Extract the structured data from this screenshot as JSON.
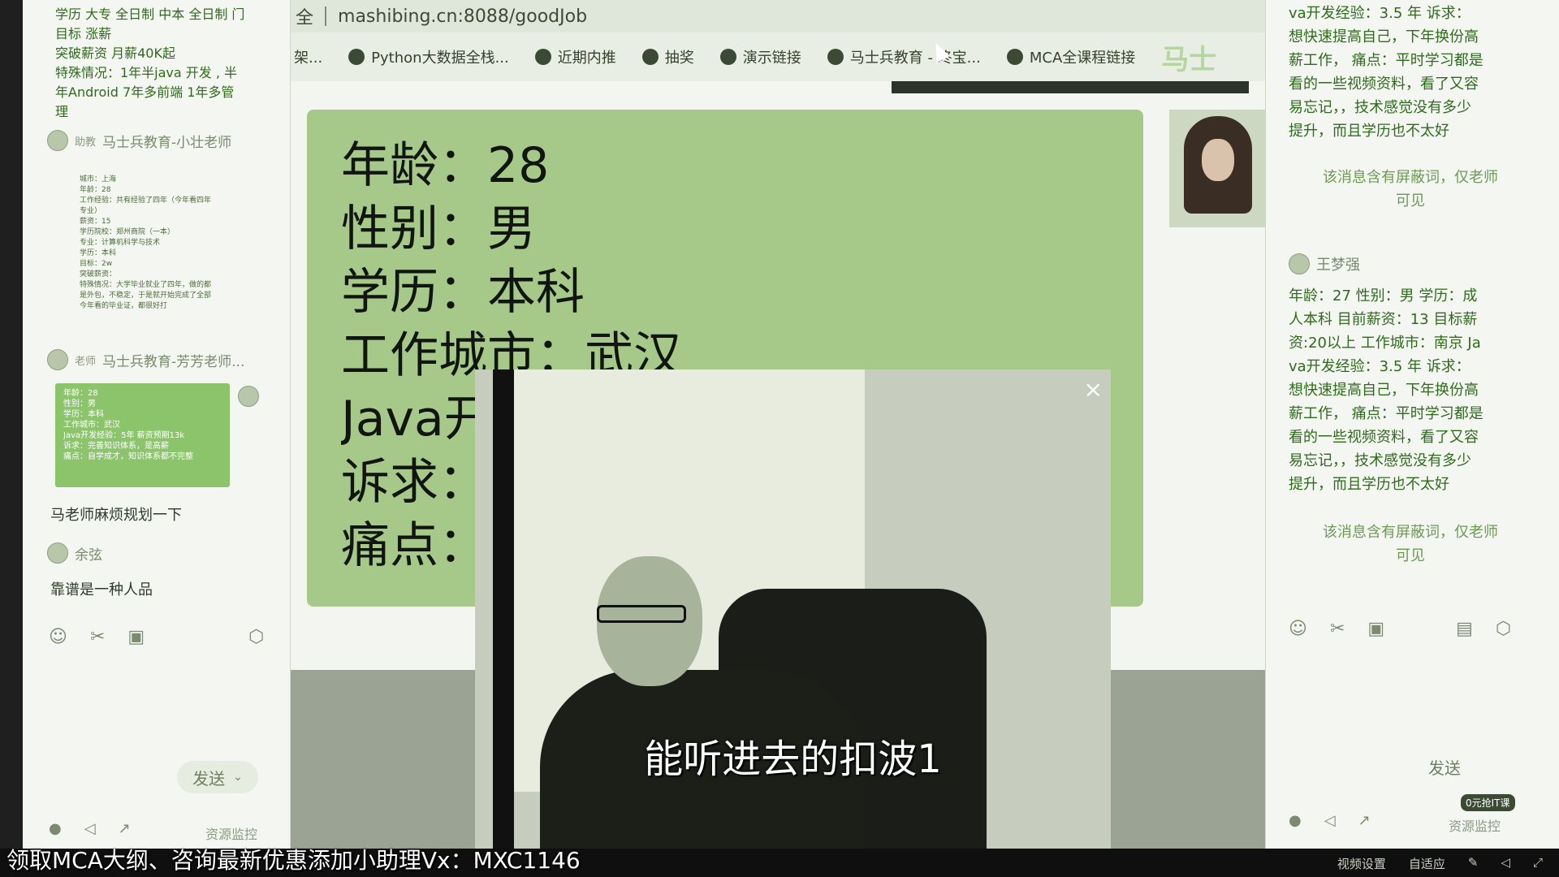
{
  "left_panel": {
    "notes": [
      "学历 大专 全日制 中本 全日制 门",
      "目标 涨薪",
      "突破薪资 月薪40K起",
      "特殊情况：1年半java 开发 , 半",
      "年Android 7年多前端 1年多管",
      "理"
    ],
    "msg1": {
      "role": "助教",
      "name": "马士兵教育-小壮老师"
    },
    "tiny_lines": [
      "城市：上海",
      "年龄：28",
      "工作经验：共有经验了四年（今年看四年",
      "专业）",
      "薪资：15",
      "学历院校：郑州商院（一本）",
      "专业：计算机科学与技术",
      "学历：本科",
      "目标：2w",
      "突破薪资：",
      "特殊情况：大学毕业就业了四年，做的都",
      "是外包，不稳定，于是就开始完成了全部",
      "今年看的毕业证，都很好打"
    ],
    "msg2": {
      "role": "老师",
      "name": "马士兵教育-芳芳老师..."
    },
    "green_lines": [
      "年龄：28",
      "性别：男",
      "学历：本科",
      "工作城市：武汉",
      "Java开发经验：5年 薪资预期13k",
      "诉求：完善知识体系，是高薪",
      "痛点：自学成才，知识体系都不完整"
    ],
    "msg3": "马老师麻烦规划一下",
    "msg4_name": "余弦",
    "msg4_text": "靠谱是一种人品",
    "send_label": "发送",
    "res_monitor": "资源监控"
  },
  "browser": {
    "url_prefix": "全",
    "url": "mashibing.cn:8088/goodJob",
    "bookmarks": [
      "架...",
      "Python大数据全栈...",
      "近期内推",
      "抽奖",
      "演示链接",
      "马士兵教育 - 咚宝...",
      "MCA全课程链接"
    ],
    "brand": "马士"
  },
  "card": {
    "lines": [
      "年龄：28",
      "性别：男",
      "学历：本科",
      "工作城市：武汉",
      "Java开",
      "诉求：",
      "痛点："
    ]
  },
  "video": {
    "subtitle": "能听进去的扣波1",
    "close": "×"
  },
  "right_panel": {
    "top_text": [
      "va开发经验：3.5 年 诉求：",
      "想快速提高自己，下年换份高",
      "薪工作， 痛点：平时学习都是",
      "看的一些视频资料，看了又容",
      "易忘记，，技术感觉没有多少",
      "提升，而且学历也不太好"
    ],
    "note1": [
      "该消息含有屏蔽词，仅老师",
      "可见"
    ],
    "user_name": "王梦强",
    "msg_text": [
      "年龄：27 性别：男 学历：成",
      "人本科 目前薪资：13 目标薪",
      "资:20以上 工作城市：南京 Ja",
      "va开发经验：3.5 年 诉求：",
      "想快速提高自己，下年换份高",
      "薪工作， 痛点：平时学习都是",
      "看的一些视频资料，看了又容",
      "易忘记，，技术感觉没有多少",
      "提升，而且学历也不太好"
    ],
    "note2": [
      "该消息含有屏蔽词，仅老师",
      "可见"
    ],
    "send_label": "发送",
    "free_badge": "0元抢IT课",
    "res_monitor": "资源监控"
  },
  "promo": "领取MCA大纲、咨询最新优惠添加小助理Vx：MXC1146",
  "bottom_controls": [
    "视频设置",
    "自适应"
  ]
}
